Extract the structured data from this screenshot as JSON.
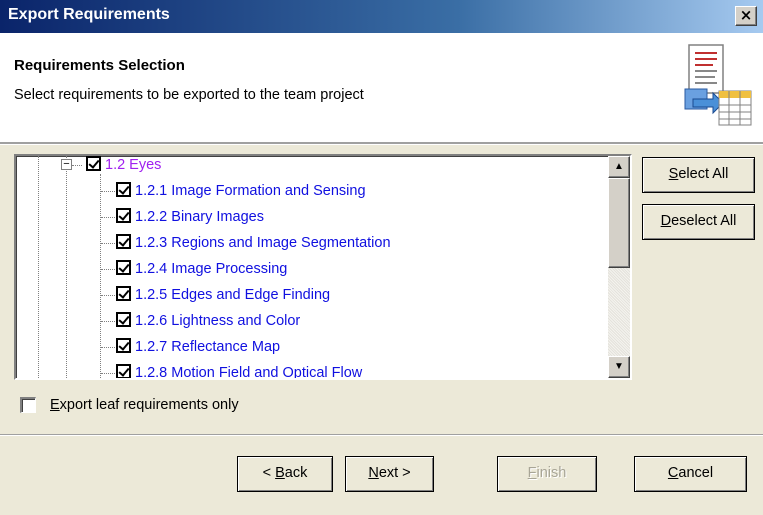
{
  "window": {
    "title": "Export Requirements",
    "close_glyph": "×"
  },
  "header": {
    "title": "Requirements Selection",
    "subtitle": "Select requirements to be exported to the team project",
    "icon": "export-to-spreadsheet-icon"
  },
  "tree": {
    "parent": {
      "label": "1.2 Eyes",
      "checked": true,
      "expanded": true
    },
    "children": [
      {
        "label": "1.2.1 Image Formation and Sensing",
        "checked": true
      },
      {
        "label": "1.2.2 Binary Images",
        "checked": true
      },
      {
        "label": "1.2.3 Regions and Image Segmentation",
        "checked": true
      },
      {
        "label": "1.2.4 Image Processing",
        "checked": true
      },
      {
        "label": "1.2.5 Edges and Edge Finding",
        "checked": true
      },
      {
        "label": "1.2.6 Lightness and Color",
        "checked": true
      },
      {
        "label": "1.2.7 Reflectance Map",
        "checked": true
      },
      {
        "label": "1.2.8 Motion Field and Optical Flow",
        "checked": true
      }
    ],
    "colors": {
      "parent": "#a020f0",
      "child": "#1010e0"
    }
  },
  "side_buttons": {
    "select_all_access": "S",
    "select_all_rest": "elect All",
    "deselect_all_access": "D",
    "deselect_all_rest": "eselect All"
  },
  "option": {
    "label_access": "E",
    "label_rest": "xport leaf requirements only",
    "checked": false
  },
  "footer_buttons": {
    "back_prefix": "< ",
    "back_access": "B",
    "back_rest": "ack",
    "next_access": "N",
    "next_rest": "ext >",
    "finish_access": "F",
    "finish_rest": "inish",
    "finish_enabled": false,
    "cancel_access": "C",
    "cancel_rest": "ancel"
  }
}
